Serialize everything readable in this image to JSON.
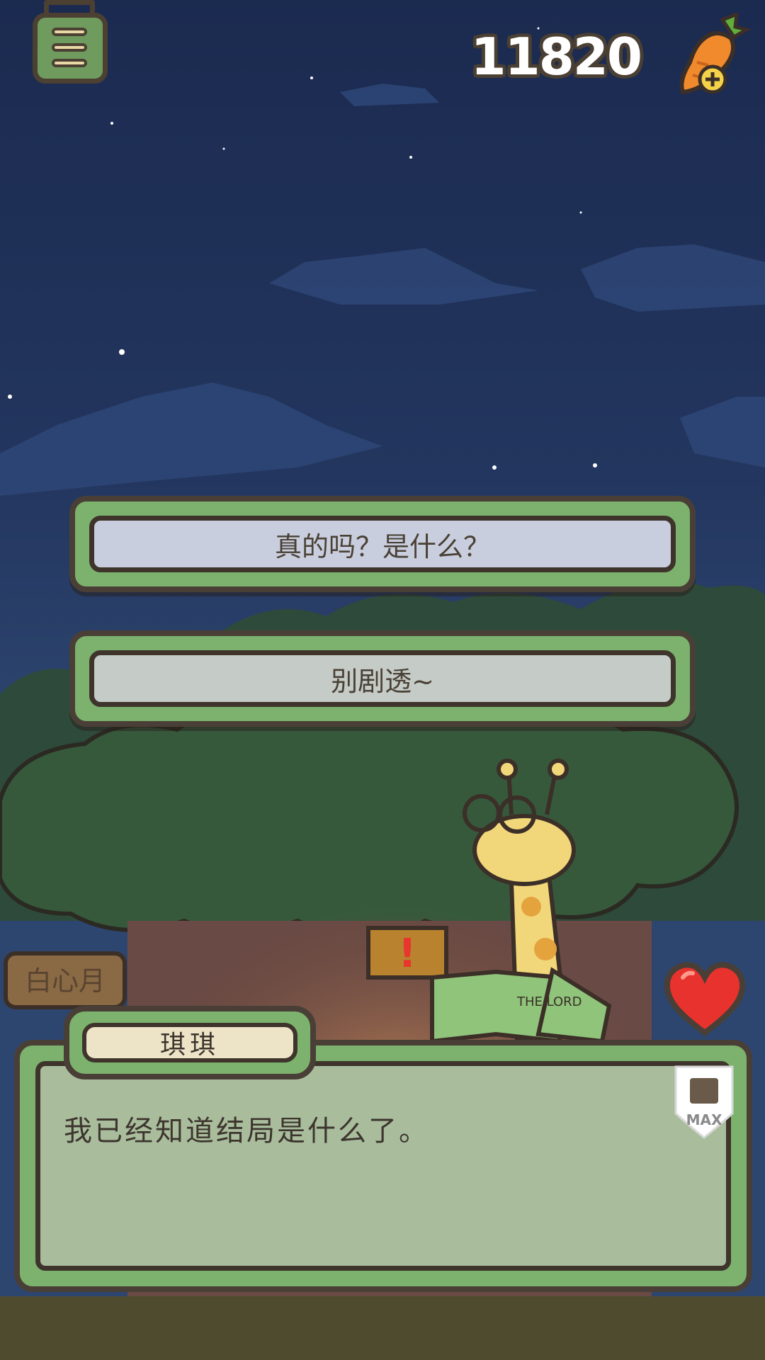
{
  "hud": {
    "menu_icon": "menu-lines-icon",
    "carrot_count": "11820",
    "carrot_icon": "carrot-add-icon"
  },
  "choices": [
    {
      "label": "真的吗？是什么？"
    },
    {
      "label": "别剧透~"
    }
  ],
  "scene": {
    "shop_sign": "白心月",
    "book_title": "THE LORD OF THE CARROTS",
    "character": "giraffe-with-glasses-reading"
  },
  "dialog": {
    "speaker": "琪琪",
    "text": "我已经知道结局是什么了。",
    "badge": "MAX",
    "heart_icon": "heart-icon"
  },
  "colors": {
    "sky": "#1f2f55",
    "button_green": "#7cb26d",
    "outline": "#4a3f36",
    "heart": "#e8322e"
  }
}
